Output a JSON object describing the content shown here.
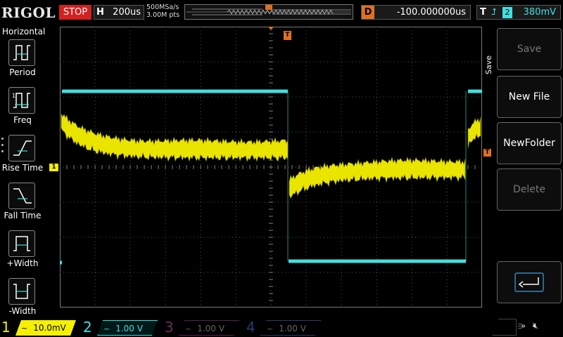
{
  "header": {
    "logo": "RIGOL",
    "run_state": "STOP",
    "horizontal_label": "H",
    "timebase": "200us",
    "sample_rate": "500MSa/s",
    "memory_depth": "3.00M pts",
    "delay_label": "D",
    "delay_value": "-100.000000us",
    "trigger_label": "T",
    "trigger_channel": "2",
    "trigger_level": "380mV",
    "trigger_marker": "T"
  },
  "left_menu": {
    "title": "Horizontal",
    "items": [
      {
        "label": "Period",
        "icon": "period-icon"
      },
      {
        "label": "Freq",
        "icon": "frequency-icon"
      },
      {
        "label": "Rise Time",
        "icon": "rise-time-icon"
      },
      {
        "label": "Fall Time",
        "icon": "fall-time-icon"
      },
      {
        "label": "+Width",
        "icon": "positive-width-icon"
      },
      {
        "label": "-Width",
        "icon": "negative-width-icon"
      }
    ]
  },
  "right_menu": {
    "title": "Save",
    "buttons": [
      {
        "label": "Save",
        "enabled": false
      },
      {
        "label": "New File",
        "enabled": true
      },
      {
        "label": "NewFolder",
        "enabled": true
      },
      {
        "label": "Delete",
        "enabled": false
      },
      {
        "label": "",
        "icon": "return-arrow-icon",
        "enabled": true
      }
    ]
  },
  "channels": [
    {
      "number": "1",
      "coupling": "~",
      "scale": "10.0mV",
      "color": "#f5f000",
      "active": true
    },
    {
      "number": "2",
      "coupling": "~",
      "scale": "1.00 V",
      "color": "#3ee0e0",
      "active": true
    },
    {
      "number": "3",
      "coupling": "~",
      "scale": "1.00 V",
      "color": "#a0308a",
      "active": false
    },
    {
      "number": "4",
      "coupling": "~",
      "scale": "1.00 V",
      "color": "#3050c0",
      "active": false
    }
  ],
  "markers": {
    "ch1_marker": "1",
    "trigger_level_marker": "T"
  },
  "status_icons": [
    "usb-icon",
    "speaker-muted-icon"
  ]
}
